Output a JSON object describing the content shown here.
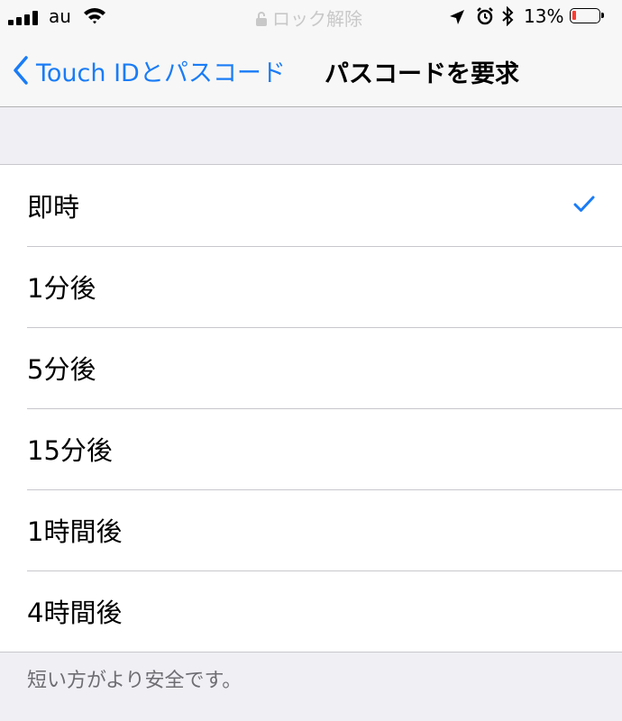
{
  "status_bar": {
    "carrier": "au",
    "lock_text": "ロック解除",
    "battery_percent": "13%",
    "battery_level": 0.13,
    "signal_icon": "cellular-signal-icon",
    "wifi_icon": "wifi-icon",
    "location_icon": "location-arrow-icon",
    "alarm_icon": "alarm-clock-icon",
    "bluetooth_icon": "bluetooth-icon"
  },
  "nav": {
    "back_label": "Touch IDとパスコード",
    "title": "パスコードを要求"
  },
  "options": [
    {
      "label": "即時",
      "selected": true
    },
    {
      "label": "1分後",
      "selected": false
    },
    {
      "label": "5分後",
      "selected": false
    },
    {
      "label": "15分後",
      "selected": false
    },
    {
      "label": "1時間後",
      "selected": false
    },
    {
      "label": "4時間後",
      "selected": false
    }
  ],
  "footer": "短い方がより安全です。",
  "colors": {
    "accent": "#1a7cf6",
    "background": "#efeff4",
    "battery_low": "#ff3b30"
  }
}
